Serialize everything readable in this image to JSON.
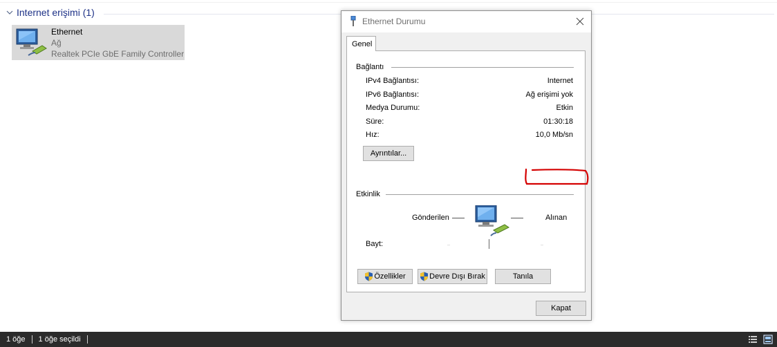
{
  "explorer": {
    "group_header": "Internet erişimi (1)",
    "adapter": {
      "name": "Ethernet",
      "network": "Ağ",
      "device": "Realtek PCIe GbE Family Controller"
    }
  },
  "statusbar": {
    "item_count": "1 öğe",
    "selected_count": "1 öğe seçildi"
  },
  "dialog": {
    "title": "Ethernet Durumu",
    "tab_general": "Genel",
    "connection": {
      "section_title": "Bağlantı",
      "rows": [
        {
          "label": "IPv4 Bağlantısı:",
          "value": "Internet"
        },
        {
          "label": "IPv6 Bağlantısı:",
          "value": "Ağ erişimi yok"
        },
        {
          "label": "Medya Durumu:",
          "value": "Etkin"
        },
        {
          "label": "Süre:",
          "value": "01:30:18"
        },
        {
          "label": "Hız:",
          "value": "10,0 Mb/sn"
        }
      ],
      "details_button": "Ayrıntılar..."
    },
    "activity": {
      "section_title": "Etkinlik",
      "sent_label": "Gönderilen",
      "received_label": "Alınan",
      "bytes_label": "Bayt:"
    },
    "buttons": {
      "properties": "Özellikler",
      "disable": "Devre Dışı Bırak",
      "diagnose": "Tanıla",
      "close": "Kapat"
    }
  },
  "colors": {
    "group_header": "#1e3287",
    "selection": "#d9d9d9",
    "statusbar": "#2b2b2b",
    "annotation": "#d40000"
  },
  "icons": [
    "chevron-down-icon",
    "network-adapter-icon",
    "ethernet-title-icon",
    "close-icon",
    "uac-shield-icon",
    "network-activity-icon",
    "details-view-icon",
    "tiles-view-icon"
  ]
}
